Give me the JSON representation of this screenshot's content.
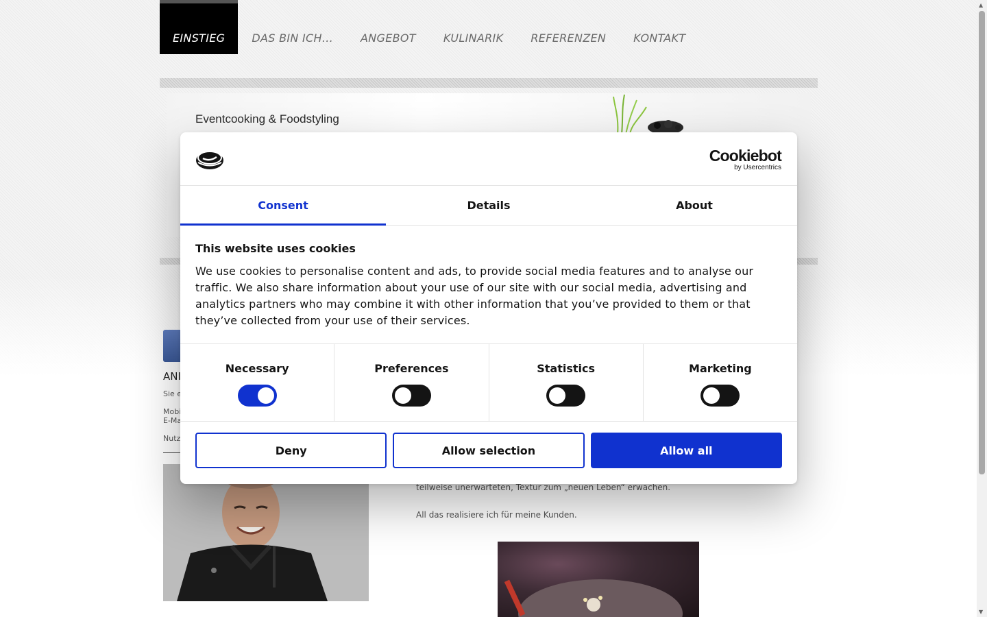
{
  "nav": {
    "items": [
      {
        "label": "EINSTIEG",
        "active": true
      },
      {
        "label": "DAS BIN ICH...",
        "active": false
      },
      {
        "label": "ANGEBOT",
        "active": false
      },
      {
        "label": "KULINARIK",
        "active": false
      },
      {
        "label": "REFERENZEN",
        "active": false
      },
      {
        "label": "KONTAKT",
        "active": false
      }
    ]
  },
  "banner": {
    "title": "Eventcooking & Foodstyling"
  },
  "left_column": {
    "heading_partial": "ANI",
    "line1_partial": "Sie e",
    "line2_partial": "Mobi",
    "line3_partial": "E-Ma",
    "line4_partial": "Nutz"
  },
  "main": {
    "line_partial": "teilweise unerwarteten, Textur zum „neuen Leben“ erwachen.",
    "line2": "All das realisiere ich für meine Kunden."
  },
  "cookie_dialog": {
    "brand": {
      "name": "Cookiebot",
      "sub": "by Usercentrics"
    },
    "tabs": [
      {
        "label": "Consent",
        "active": true
      },
      {
        "label": "Details",
        "active": false
      },
      {
        "label": "About",
        "active": false
      }
    ],
    "title": "This website uses cookies",
    "text": "We use cookies to personalise content and ads, to provide social media features and to analyse our traffic. We also share information about your use of our site with our social media, advertising and analytics partners who may combine it with other information that you’ve provided to them or that they’ve collected from your use of their services.",
    "categories": [
      {
        "label": "Necessary",
        "enabled": true
      },
      {
        "label": "Preferences",
        "enabled": false
      },
      {
        "label": "Statistics",
        "enabled": false
      },
      {
        "label": "Marketing",
        "enabled": false
      }
    ],
    "buttons": {
      "deny": "Deny",
      "allow_selection": "Allow selection",
      "allow_all": "Allow all"
    }
  },
  "colors": {
    "accent": "#1032cf",
    "text": "#141414",
    "nav_active_bg": "#000000"
  },
  "icons": [
    "cookie-logo-icon",
    "facebook-icon",
    "scroll-up-icon",
    "scroll-down-icon"
  ]
}
